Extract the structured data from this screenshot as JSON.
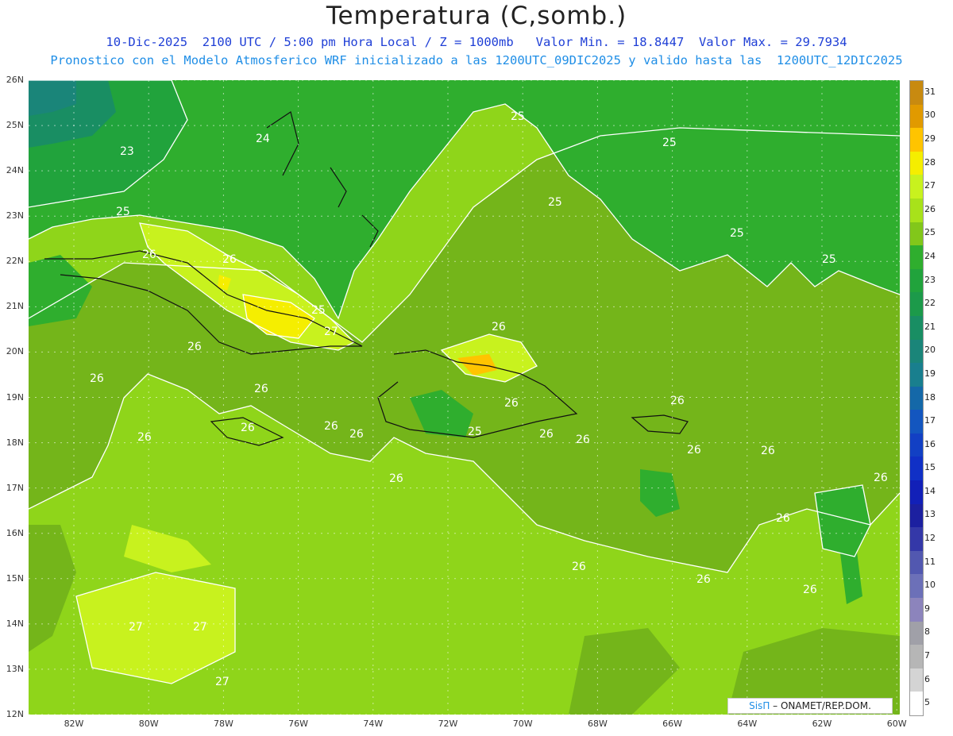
{
  "header": {
    "title": "Temperatura (C,somb.)",
    "line1": "10-Dic-2025  2100 UTC / 5:00 pm Hora Local / Z = 1000mb   Valor Min. = 18.8447  Valor Max. = 29.7934",
    "line2": "Pronostico con el Modelo Atmosferico WRF inicializado a las 1200UTC_09DIC2025 y valido hasta las  1200UTC_12DIC2025"
  },
  "axes": {
    "lat_labels": [
      "26N",
      "25N",
      "24N",
      "23N",
      "22N",
      "21N",
      "20N",
      "19N",
      "18N",
      "17N",
      "16N",
      "15N",
      "14N",
      "13N",
      "12N"
    ],
    "lon_labels": [
      "82W",
      "80W",
      "78W",
      "76W",
      "74W",
      "72W",
      "70W",
      "68W",
      "66W",
      "64W",
      "62W",
      "60W"
    ]
  },
  "colorbar": {
    "labels": [
      "31",
      "30",
      "29",
      "28",
      "27",
      "26",
      "25",
      "24",
      "23",
      "22",
      "21",
      "20",
      "19",
      "18",
      "17",
      "16",
      "15",
      "14",
      "13",
      "12",
      "11",
      "10",
      "9",
      "8",
      "7",
      "6",
      "5"
    ],
    "colors": [
      "#c88a10",
      "#e19a00",
      "#ffc400",
      "#f5ee00",
      "#c8f21e",
      "#a8e21a",
      "#82c71a",
      "#2fae2e",
      "#21a33c",
      "#1c9a4a",
      "#198e63",
      "#1a8579",
      "#197f8e",
      "#1468a8",
      "#1356bf",
      "#1240c4",
      "#1030c6",
      "#1220b8",
      "#1c20a0",
      "#3438a8",
      "#5258b0",
      "#6c70b8",
      "#8c84bc",
      "#a0a0a8",
      "#b6b6b6",
      "#d4d4d4",
      "#ffffff"
    ]
  },
  "contour_labels": [
    "23",
    "24",
    "25",
    "25",
    "25",
    "25",
    "25",
    "25",
    "25",
    "25",
    "26",
    "26",
    "26",
    "26",
    "26",
    "26",
    "26",
    "26",
    "26",
    "26",
    "26",
    "26",
    "26",
    "26",
    "26",
    "26",
    "26",
    "26",
    "26",
    "26",
    "26",
    "26",
    "27",
    "27",
    "27",
    "27"
  ],
  "credit": {
    "brand": "SisΠ",
    "text": "– ONAMET/REP.DOM."
  }
}
